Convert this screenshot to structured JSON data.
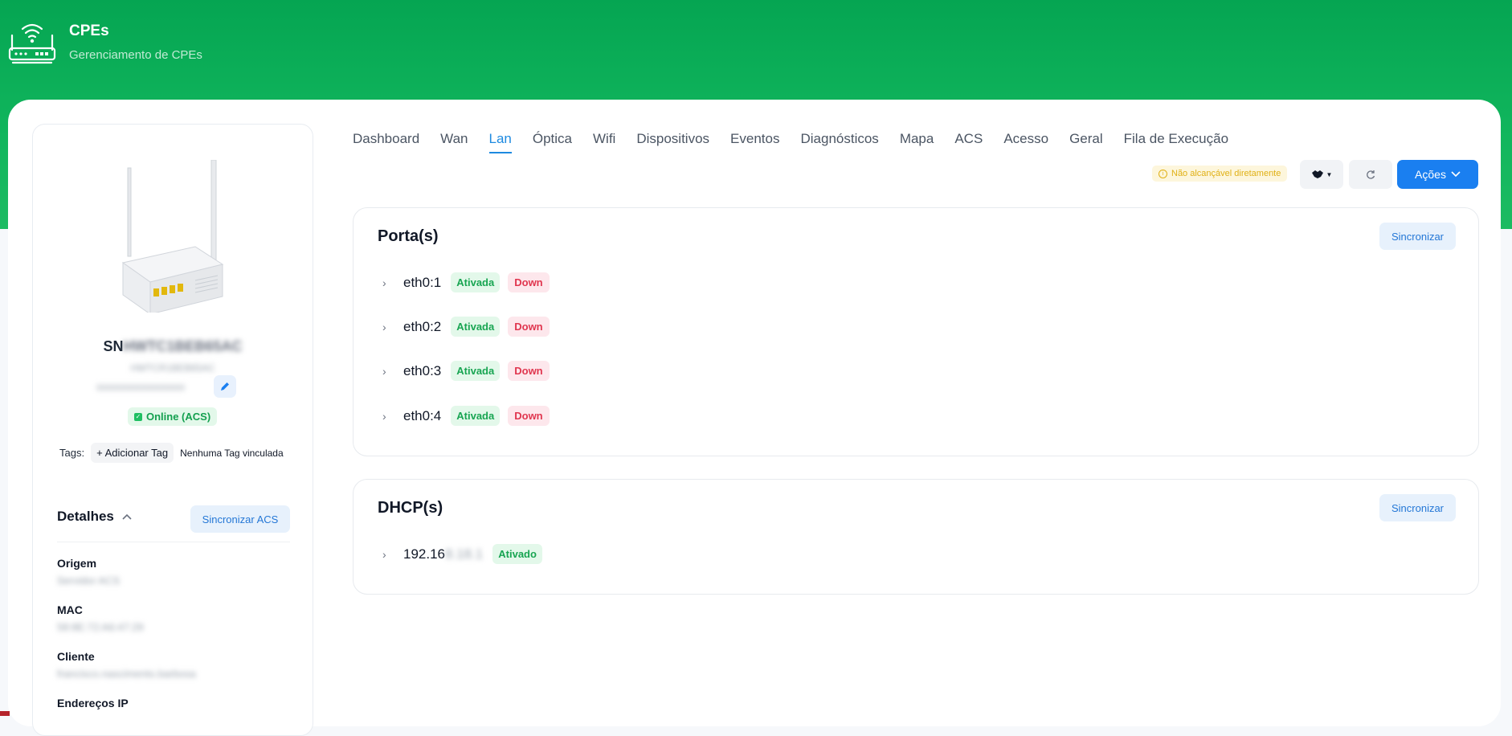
{
  "header": {
    "title": "CPEs",
    "subtitle": "Gerenciamento de CPEs",
    "icon": "router-icon"
  },
  "device": {
    "sn_prefix": "SN",
    "sn_masked": "HWTC1BEB65AC",
    "model_masked": "HWTCR1BEB65AC",
    "id_masked": "000000000000000000",
    "status": "Online (ACS)",
    "tags_label": "Tags:",
    "add_tag": "+ Adicionar Tag",
    "no_tag": "Nenhuma Tag vinculada"
  },
  "details": {
    "title": "Detalhes",
    "sync_label": "Sincronizar ACS",
    "fields": [
      {
        "label": "Origem",
        "value": "Servidor ACS"
      },
      {
        "label": "MAC",
        "value": "58:8E:72:A6:47:29"
      },
      {
        "label": "Cliente",
        "value": "francisco.nascimento.barbosa"
      },
      {
        "label": "Endereços IP",
        "value": ""
      }
    ]
  },
  "tabs": [
    "Dashboard",
    "Wan",
    "Lan",
    "Óptica",
    "Wifi",
    "Dispositivos",
    "Eventos",
    "Diagnósticos",
    "Mapa",
    "ACS",
    "Acesso",
    "Geral",
    "Fila de Execução"
  ],
  "active_tab": "Lan",
  "toolbar": {
    "warning": "Não alcançável diretamente",
    "acoes_label": "Ações"
  },
  "ports": {
    "title": "Porta(s)",
    "sync_label": "Sincronizar",
    "items": [
      {
        "name": "eth0:1",
        "state": "Ativada",
        "link": "Down"
      },
      {
        "name": "eth0:2",
        "state": "Ativada",
        "link": "Down"
      },
      {
        "name": "eth0:3",
        "state": "Ativada",
        "link": "Down"
      },
      {
        "name": "eth0:4",
        "state": "Ativada",
        "link": "Down"
      }
    ]
  },
  "dhcp": {
    "title": "DHCP(s)",
    "sync_label": "Sincronizar",
    "items": [
      {
        "ip_prefix": "192.16",
        "ip_masked": "8.18.1",
        "state": "Ativado"
      }
    ]
  }
}
